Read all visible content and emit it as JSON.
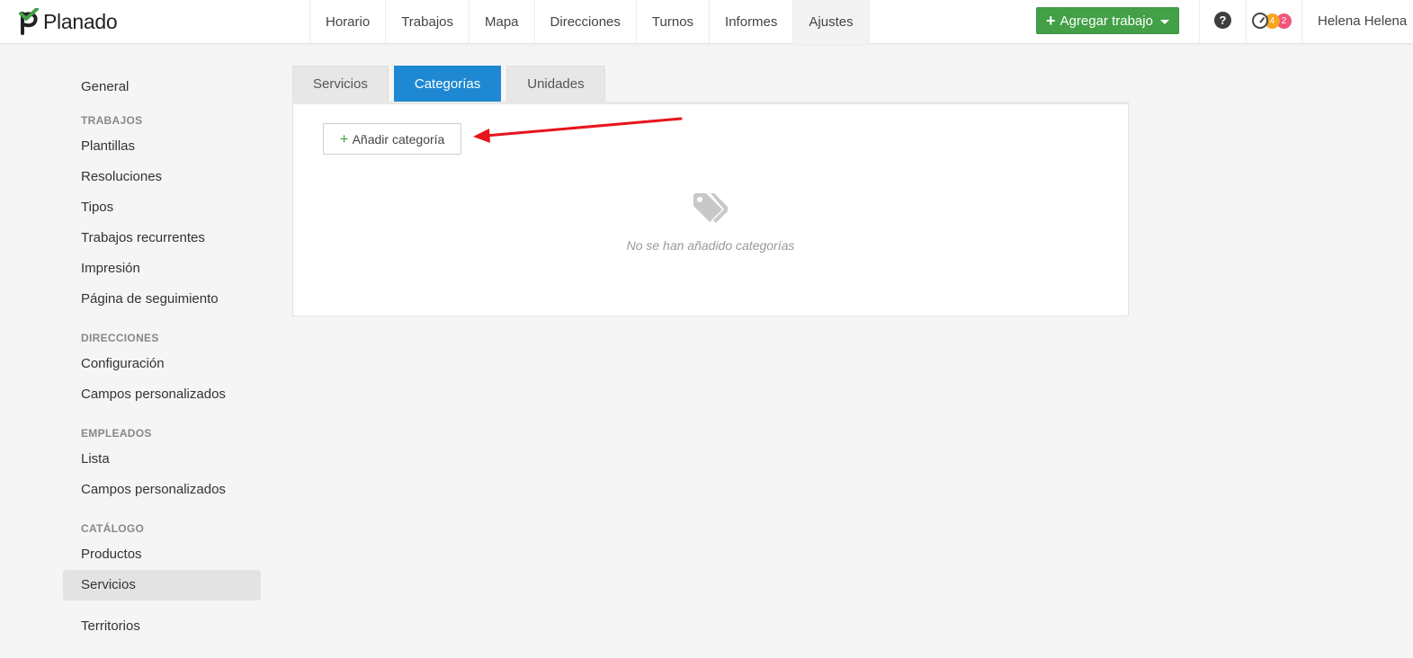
{
  "app": {
    "logo_text": "Planado",
    "brand_green": "#43a047",
    "accent_blue": "#1e88d3"
  },
  "nav": {
    "items": [
      {
        "label": "Horario"
      },
      {
        "label": "Trabajos"
      },
      {
        "label": "Mapa"
      },
      {
        "label": "Direcciones"
      },
      {
        "label": "Turnos"
      },
      {
        "label": "Informes"
      },
      {
        "label": "Ajustes",
        "active": true
      }
    ]
  },
  "header": {
    "add_job_label": "Agregar trabajo",
    "help_label": "?",
    "badge_orange": "4",
    "badge_red": "2",
    "user_name": "Helena Helena"
  },
  "sidebar": {
    "general": "General",
    "sections": [
      {
        "heading": "TRABAJOS",
        "items": [
          "Plantillas",
          "Resoluciones",
          "Tipos",
          "Trabajos recurrentes",
          "Impresión",
          "Página de seguimiento"
        ]
      },
      {
        "heading": "DIRECCIONES",
        "items": [
          "Configuración",
          "Campos personalizados"
        ]
      },
      {
        "heading": "EMPLEADOS",
        "items": [
          "Lista",
          "Campos personalizados"
        ]
      },
      {
        "heading": "CATÁLOGO",
        "items": [
          "Productos",
          "Servicios"
        ],
        "active_item": "Servicios"
      }
    ],
    "territories": "Territorios"
  },
  "tabs": [
    {
      "label": "Servicios"
    },
    {
      "label": "Categorías",
      "active": true
    },
    {
      "label": "Unidades"
    }
  ],
  "panel": {
    "add_category_label": "Añadir categoría",
    "empty_text": "No se han añadido categorías",
    "empty_icon": "tags-icon"
  },
  "annotation": {
    "arrow_color": "#e8141c"
  }
}
